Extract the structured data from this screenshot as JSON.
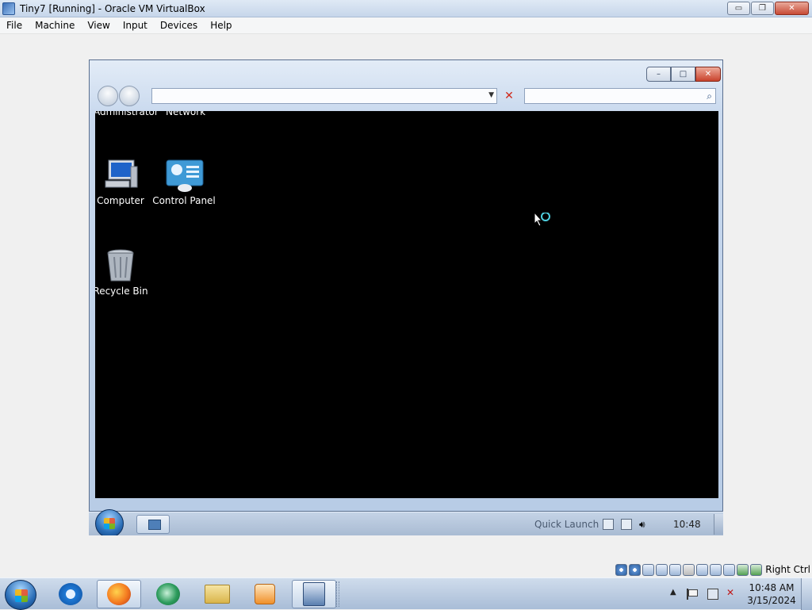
{
  "host_window": {
    "title": "Tiny7 [Running] - Oracle VM VirtualBox",
    "buttons": {
      "minimize": "▭",
      "maximize": "❐",
      "close": "✕"
    }
  },
  "host_menu": [
    "File",
    "Machine",
    "View",
    "Input",
    "Devices",
    "Help"
  ],
  "guest_window": {
    "buttons": {
      "minimize": "–",
      "maximize": "□",
      "close": "✕"
    },
    "address_value": "",
    "address_dropdown": "▼",
    "stop_icon": "✕",
    "search_value": "",
    "search_icon": "⌕"
  },
  "desktop_icons": {
    "top_row_partial": [
      "Administrator",
      "Network"
    ],
    "computer": "Computer",
    "control_panel": "Control Panel",
    "recycle_bin": "Recycle Bin"
  },
  "guest_taskbar": {
    "quick_launch": "Quick Launch",
    "clock": "10:48"
  },
  "status_bar": {
    "host_key": "Right Ctrl",
    "icons": [
      "hard-disk-icon",
      "optical-drive-icon",
      "audio-icon",
      "network-icon",
      "usb-icon",
      "shared-folders-icon",
      "display-icon",
      "recording-icon",
      "cpu-icon",
      "mouse-integration-icon",
      "keyboard-icon"
    ]
  },
  "host_taskbar": {
    "clock_time": "10:48 AM",
    "clock_date": "3/15/2024",
    "tray_up": "▲",
    "volume_icon": "✕"
  },
  "colors": {
    "desktop_background": "#000000",
    "title_gradient_top": "#dfe9f5",
    "taskbar_base": "#a9bdd7"
  }
}
